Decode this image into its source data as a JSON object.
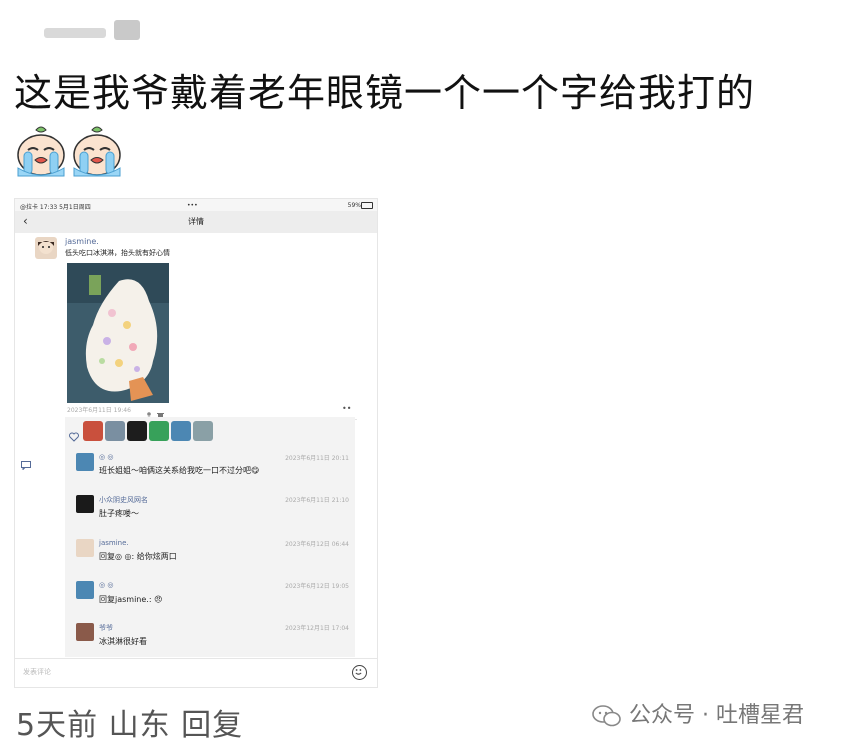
{
  "post": {
    "text": "这是我爷戴着老年眼镜一个一个字给我打的",
    "emoji_icon": "crying-face-icon"
  },
  "screenshot": {
    "status": {
      "left": "@拉卡  17:33  5月1日周四",
      "center": "•••",
      "right": "59%"
    },
    "nav": {
      "back": "‹",
      "title": "详情"
    },
    "moment": {
      "author": "jasmine.",
      "text": "低头吃口冰淇淋，抬头就有好心情",
      "timestamp": "2023年6月11日 19:46",
      "more": "••"
    },
    "likes_icon": "heart-icon",
    "comments": [
      {
        "name": "◎ ◎",
        "time": "2023年6月11日 20:11",
        "text": "班长姐姐～咱俩这关系给我吃一口不过分吧😋"
      },
      {
        "name": "小众阴史风网名",
        "time": "2023年6月11日 21:10",
        "text": "肚子疼喽～"
      },
      {
        "name": "jasmine.",
        "time": "2023年6月12日 06:44",
        "text": "回复◎ ◎: 给你炫两口"
      },
      {
        "name": "◎ ◎",
        "time": "2023年6月12日 19:05",
        "text": "回复jasmine.: 😠"
      },
      {
        "name": "爷爷",
        "time": "2023年12月1日 17:04",
        "text": "冰淇淋很好看"
      }
    ],
    "input_placeholder": "发表评论"
  },
  "footer": {
    "meta": "5天前 山东 回复",
    "watermark": "公众号 · 吐槽星君"
  }
}
